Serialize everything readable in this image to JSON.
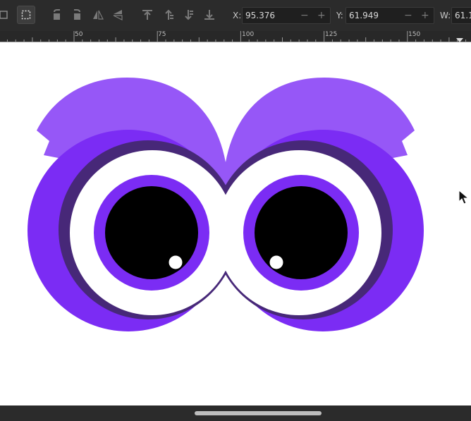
{
  "toolbar": {
    "x_label": "X:",
    "x_value": "95.376",
    "y_label": "Y:",
    "y_value": "61.949",
    "w_label": "W:",
    "w_value": "61.1",
    "stepper_minus": "−",
    "stepper_plus": "+"
  },
  "ruler": {
    "labels": [
      "50",
      "75",
      "100",
      "125",
      "150"
    ]
  },
  "colors": {
    "brow": "#9657f7",
    "outer_ring": "#7b2cf4",
    "shadow_ring": "#472878",
    "iris_ring": "#7b2cf4",
    "pupil": "#000000",
    "highlight": "#ffffff",
    "toolbar_bg": "#2b2b2b"
  },
  "icons": {
    "select_tool": "select-rect-icon",
    "mouse_pointer": "cursor-arrow-icon"
  }
}
